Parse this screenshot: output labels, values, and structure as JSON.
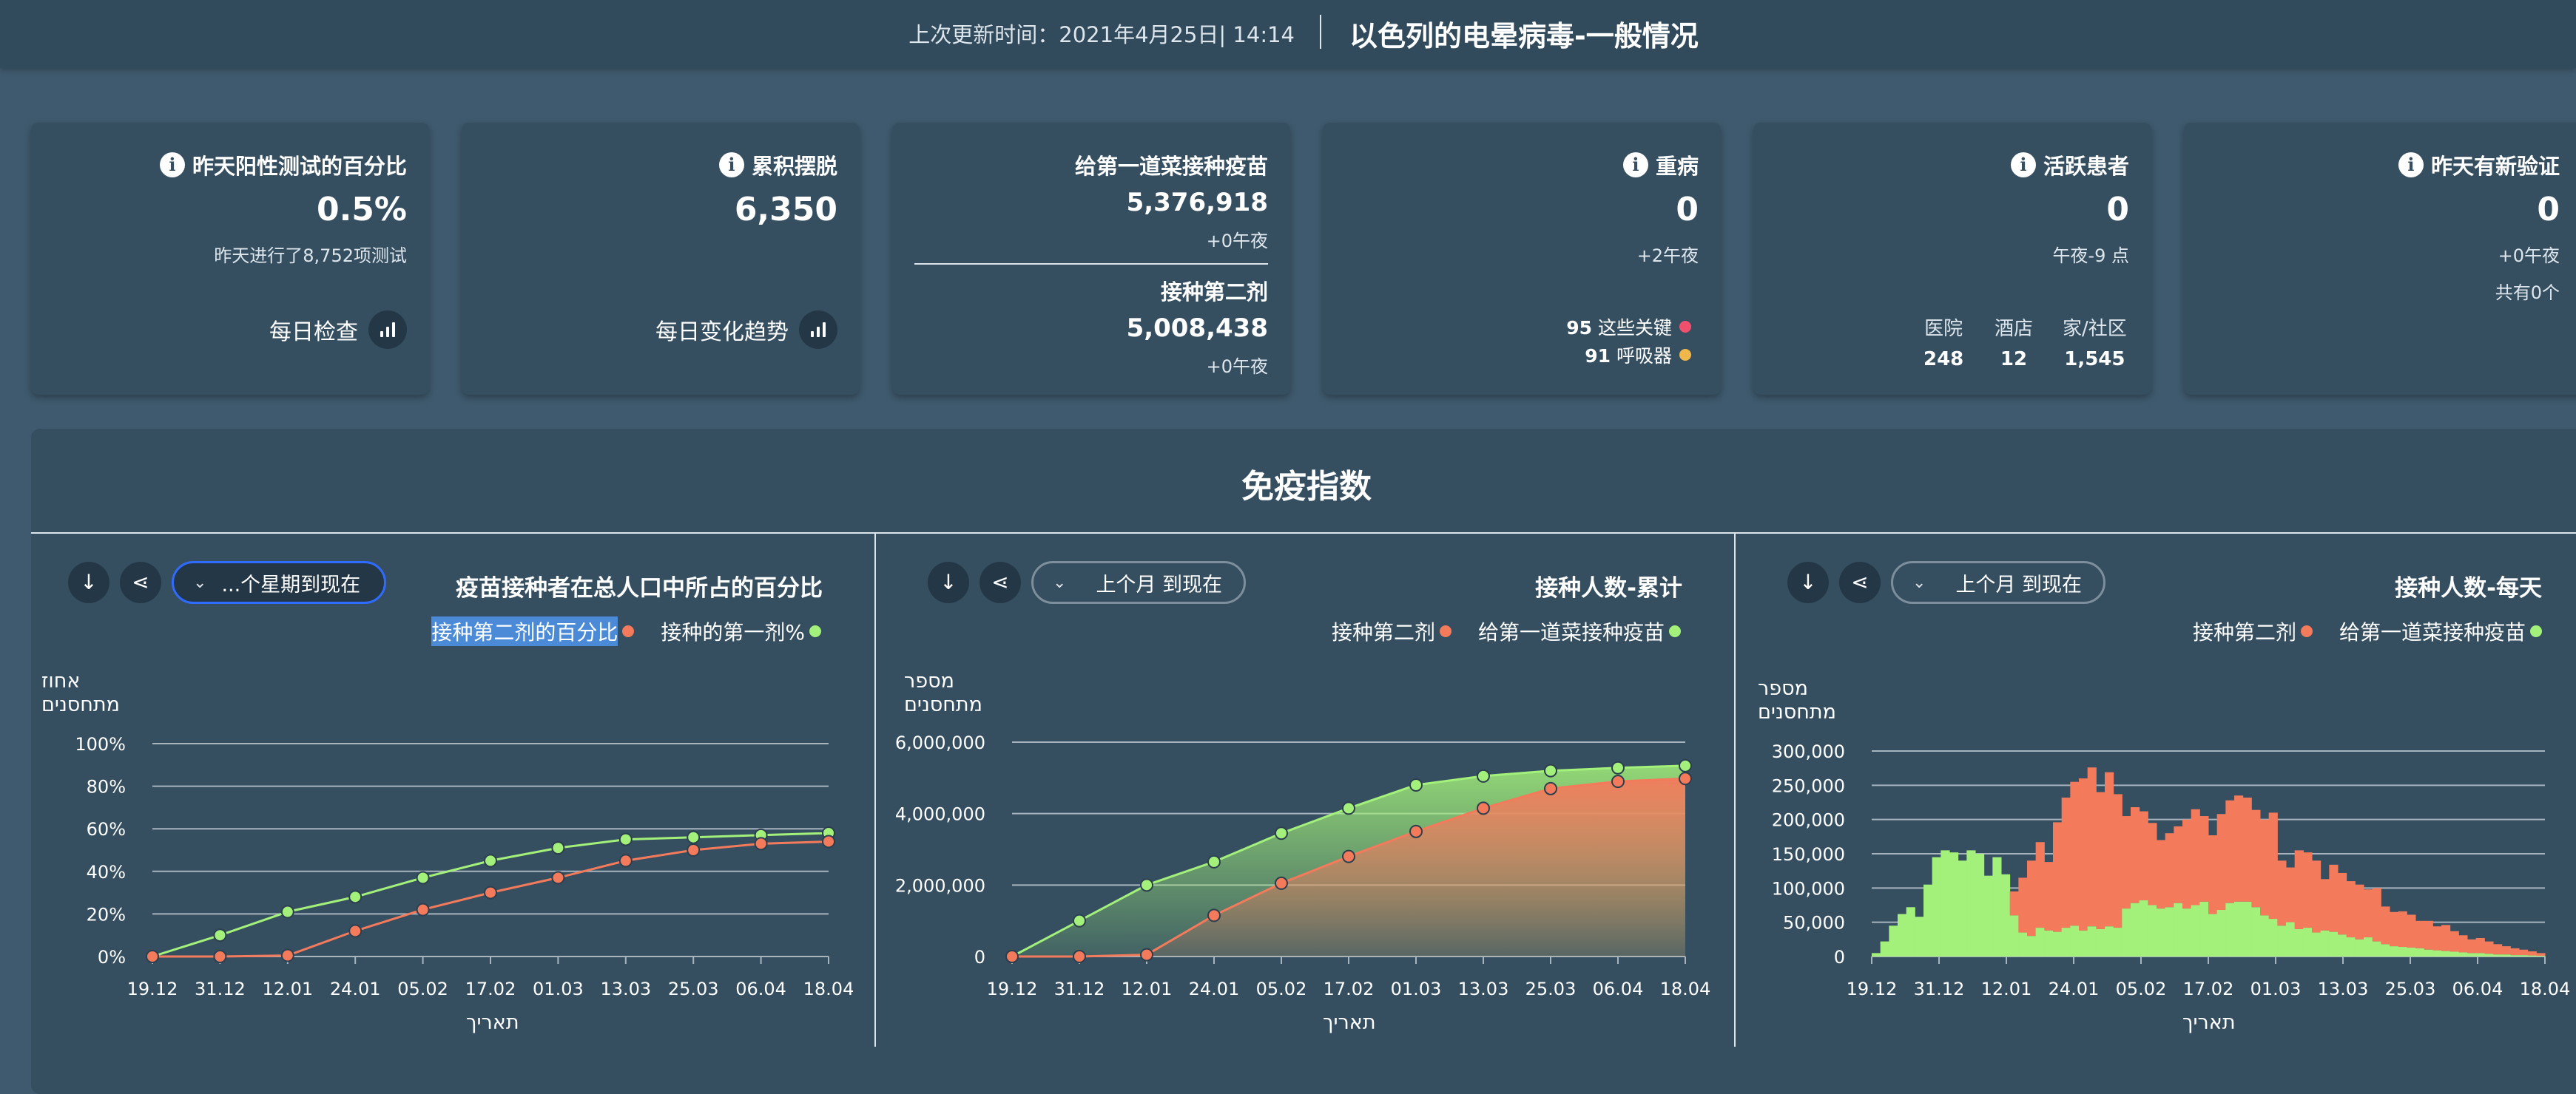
{
  "header": {
    "updated": "上次更新时间：2021年4月25日| 14:14",
    "title": "以色列的电晕病毒-一般情况"
  },
  "cards": {
    "positive": {
      "title": "昨天阳性测试的百分比",
      "value": "0.5%",
      "sub": "昨天进行了8,752项测试",
      "action": "每日检查"
    },
    "recovered": {
      "title": "累积摆脱",
      "value": "6,350",
      "action": "每日变化趋势"
    },
    "vaccine": {
      "title1": "给第一道菜接种疫苗",
      "value1": "5,376,918",
      "sub1": "+0午夜",
      "title2": "接种第二剂",
      "value2": "5,008,438",
      "sub2": "+0午夜"
    },
    "severe": {
      "title": "重病",
      "value": "0",
      "sub": "+2午夜",
      "critical_value": "95",
      "critical_label": "这些关键",
      "vent_value": "91",
      "vent_label": "呼吸器"
    },
    "active": {
      "title": "活跃患者",
      "value": "0",
      "sub": "午夜-9 点",
      "hospital_label": "医院",
      "hospital_value": "248",
      "hotel_label": "酒店",
      "hotel_value": "12",
      "home_label": "家/社区",
      "home_value": "1,545"
    },
    "verified": {
      "title": "昨天有新验证",
      "value": "0",
      "sub": "+0午夜",
      "sub2": "共有0个"
    }
  },
  "panel": {
    "title": "免疫指数",
    "charts": [
      {
        "filter": "...个星期到现在",
        "title": "疫苗接种者在总人口中所占的百分比",
        "legend_second": "接种第二剂的百分比",
        "legend_first": "接种的第一剂%",
        "ytitle": "אחוז\nמתחסנים",
        "xtitle": "תאריך"
      },
      {
        "filter": "上个月 到现在",
        "title": "接种人数-累计",
        "legend_second": "接种第二剂",
        "legend_first": "给第一道菜接种疫苗",
        "ytitle": "מספר\nמתחסנים",
        "xtitle": "תאריך"
      },
      {
        "filter": "上个月 到现在",
        "title": "接种人数-每天",
        "legend_second": "接种第二剂",
        "legend_first": "给第一道菜接种疫苗",
        "ytitle": "מספר\nמתחסנים",
        "xtitle": "תאריך"
      }
    ]
  },
  "colors": {
    "first": "#a3f07a",
    "second": "#f47a5c",
    "critical": "#f0506e",
    "vent": "#f0b84a",
    "active_border": "#2f6bff"
  },
  "icons": [
    "info-icon",
    "bar-chart-icon",
    "download-icon",
    "share-icon",
    "chevron-down-icon"
  ],
  "chart_data": [
    {
      "type": "line",
      "x": [
        "19.12",
        "31.12",
        "12.01",
        "24.01",
        "05.02",
        "17.02",
        "01.03",
        "13.03",
        "25.03",
        "06.04",
        "18.04"
      ],
      "xticks": [
        "19.12",
        "31.12",
        "12.01",
        "24.01",
        "05.02",
        "17.02",
        "01.03",
        "13.03",
        "25.03",
        "06.04",
        "18.04"
      ],
      "ylim": [
        0,
        100
      ],
      "yticks": [
        "0%",
        "20%",
        "40%",
        "60%",
        "80%",
        "100%"
      ],
      "series": [
        {
          "name": "接种的第一剂%",
          "values": [
            0,
            10,
            21,
            28,
            37,
            45,
            51,
            55,
            56,
            57,
            58
          ]
        },
        {
          "name": "接种第二剂的百分比",
          "values": [
            0,
            0,
            0.5,
            12,
            22,
            30,
            37,
            45,
            50,
            53,
            54
          ]
        }
      ]
    },
    {
      "type": "area",
      "x": [
        "19.12",
        "31.12",
        "12.01",
        "24.01",
        "05.02",
        "17.02",
        "01.03",
        "13.03",
        "25.03",
        "06.04",
        "18.04"
      ],
      "xticks": [
        "19.12",
        "31.12",
        "12.01",
        "24.01",
        "05.02",
        "17.02",
        "01.03",
        "13.03",
        "25.03",
        "06.04",
        "18.04"
      ],
      "ylim": [
        0,
        6000000
      ],
      "yticks": [
        "0",
        "2,000,000",
        "4,000,000",
        "6,000,000"
      ],
      "series": [
        {
          "name": "给第一道菜接种疫苗",
          "values": [
            0,
            1000000,
            2000000,
            2650000,
            3450000,
            4150000,
            4800000,
            5050000,
            5200000,
            5280000,
            5340000
          ]
        },
        {
          "name": "接种第二剂",
          "values": [
            0,
            0,
            50000,
            1150000,
            2050000,
            2800000,
            3500000,
            4150000,
            4700000,
            4900000,
            4980000
          ]
        }
      ]
    },
    {
      "type": "bar",
      "xticks": [
        "19.12",
        "31.12",
        "12.01",
        "24.01",
        "05.02",
        "17.02",
        "01.03",
        "13.03",
        "25.03",
        "06.04",
        "18.04"
      ],
      "ylim": [
        0,
        300000
      ],
      "yticks": [
        "0",
        "50,000",
        "100,000",
        "150,000",
        "200,000",
        "250,000",
        "300,000"
      ],
      "series": [
        {
          "name": "给第一道菜接种疫苗",
          "values": [
            5000,
            22000,
            45000,
            62000,
            72000,
            58000,
            105000,
            145000,
            155000,
            152000,
            140000,
            155000,
            150000,
            118000,
            145000,
            120000,
            60000,
            35000,
            30000,
            42000,
            38000,
            36000,
            42000,
            45000,
            38000,
            44000,
            40000,
            44000,
            42000,
            70000,
            78000,
            82000,
            75000,
            70000,
            72000,
            78000,
            70000,
            75000,
            80000,
            62000,
            68000,
            78000,
            80000,
            80000,
            72000,
            60000,
            55000,
            45000,
            50000,
            40000,
            42000,
            35000,
            38000,
            36000,
            32000,
            28000,
            25000,
            28000,
            22000,
            18000,
            15000,
            14000,
            13000,
            12000,
            10000,
            9000,
            8000,
            7000,
            6000,
            5000,
            5000,
            4000,
            3000,
            3000,
            2000,
            2000,
            1500,
            1000
          ]
        },
        {
          "name": "接种第二剂",
          "values": [
            0,
            0,
            0,
            0,
            0,
            0,
            0,
            0,
            0,
            0,
            0,
            0,
            0,
            0,
            0,
            0,
            35000,
            80000,
            110000,
            125000,
            100000,
            160000,
            190000,
            210000,
            222000,
            232000,
            200000,
            225000,
            195000,
            135000,
            140000,
            130000,
            120000,
            100000,
            108000,
            112000,
            130000,
            140000,
            125000,
            115000,
            140000,
            150000,
            155000,
            152000,
            142000,
            140000,
            155000,
            95000,
            80000,
            115000,
            110000,
            105000,
            75000,
            98000,
            90000,
            82000,
            80000,
            70000,
            78000,
            55000,
            50000,
            52000,
            48000,
            40000,
            42000,
            35000,
            38000,
            30000,
            25000,
            20000,
            22000,
            18000,
            15000,
            12000,
            10000,
            8000,
            6000,
            4000
          ]
        }
      ]
    }
  ]
}
